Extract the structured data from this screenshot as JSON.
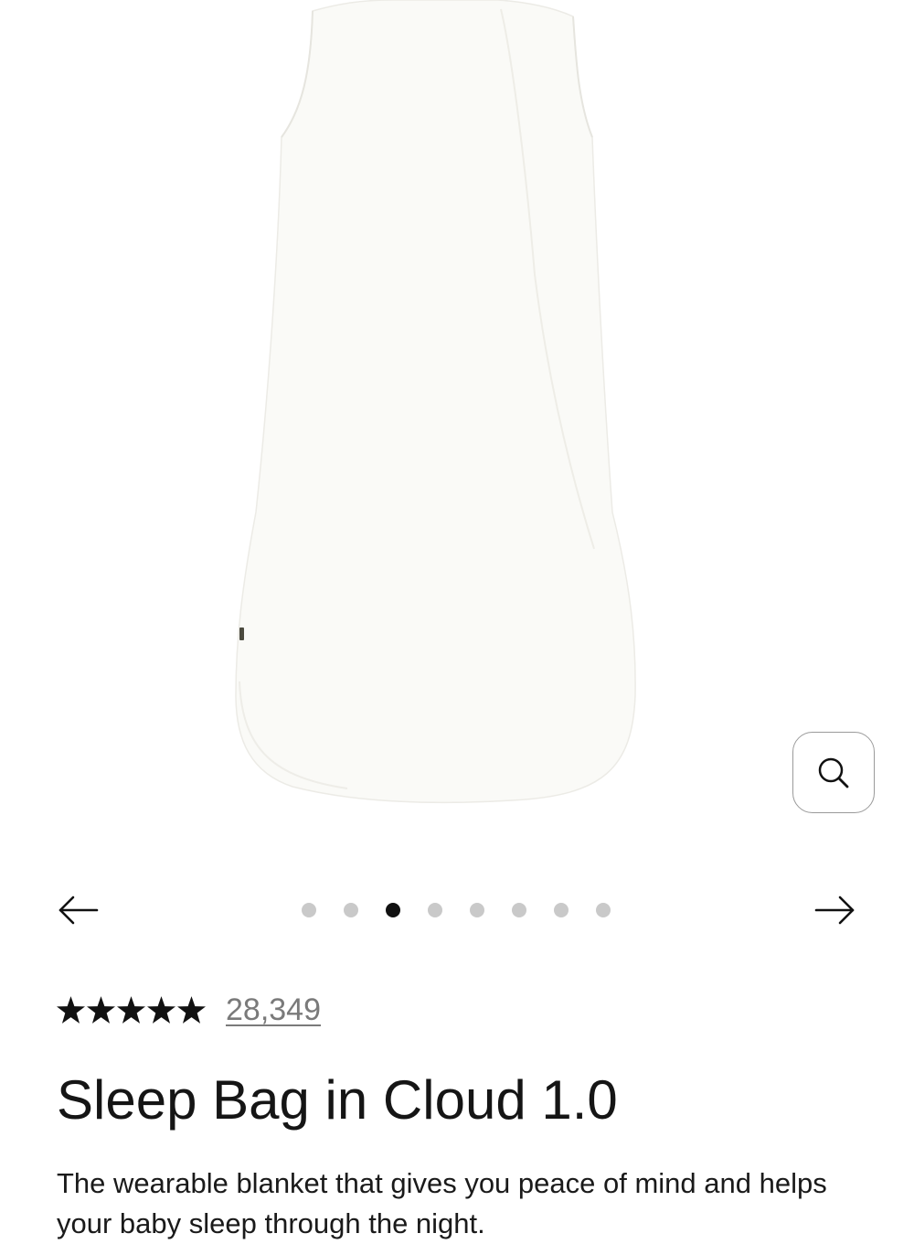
{
  "product": {
    "image_icon": "sleep-bag-product-photo",
    "title": "Sleep Bag in Cloud 1.0",
    "description": "The wearable blanket that gives you peace of mind and helps your baby sleep through the night."
  },
  "gallery": {
    "zoom_icon": "search-icon",
    "prev_icon": "arrow-left-icon",
    "next_icon": "arrow-right-icon",
    "total_slides": 8,
    "active_slide": 3
  },
  "reviews": {
    "stars": 5,
    "count": "28,349"
  },
  "colors": {
    "text": "#151515",
    "muted": "#7a7a7a",
    "dot_inactive": "#c9c9c9",
    "dot_active": "#111111",
    "product_fabric": "#fafaf7"
  }
}
